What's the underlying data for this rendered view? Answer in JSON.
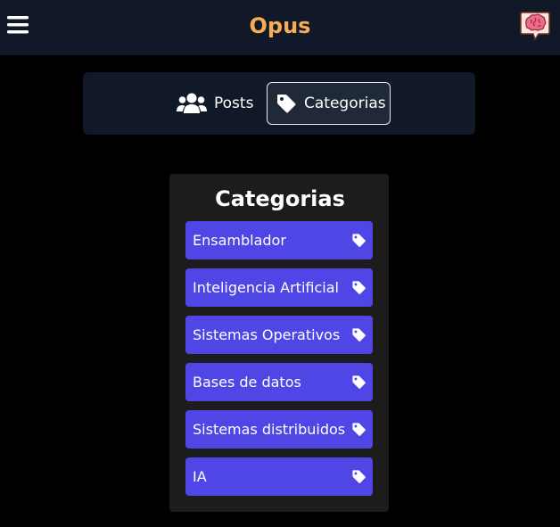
{
  "header": {
    "title": "Opus",
    "menu_icon": "hamburger-menu-icon",
    "logo_icon": "brain-speech-bubble-icon",
    "title_color": "#f6ad55",
    "background": "#111827"
  },
  "tabs": [
    {
      "label": "Posts",
      "icon": "users-icon",
      "active": false
    },
    {
      "label": "Categorias",
      "icon": "tag-icon",
      "active": true
    }
  ],
  "categories_panel": {
    "title": "Categorias",
    "item_color": "#4f46e5",
    "item_icon": "tag-icon",
    "items": [
      {
        "label": "Ensamblador"
      },
      {
        "label": "Inteligencia Artificial"
      },
      {
        "label": "Sistemas Operativos"
      },
      {
        "label": "Bases de datos"
      },
      {
        "label": "Sistemas distribuidos"
      },
      {
        "label": "IA"
      }
    ]
  }
}
